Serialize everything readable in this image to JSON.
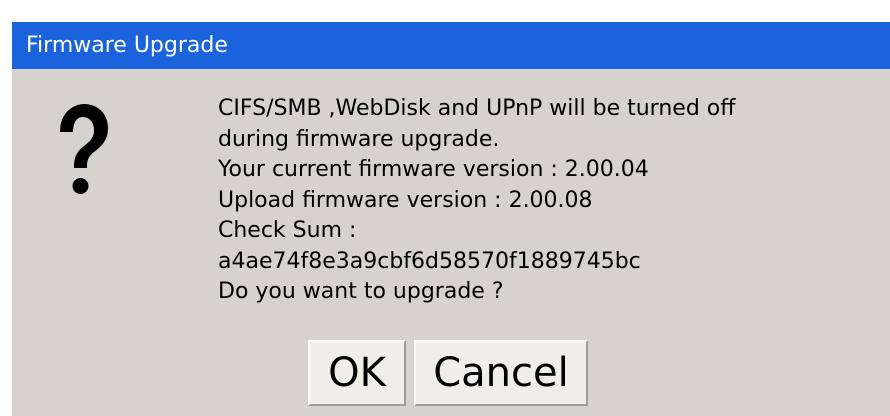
{
  "dialog": {
    "title": "Firmware Upgrade",
    "icon": "question-mark-icon",
    "message_lines": [
      "CIFS/SMB ,WebDisk and UPnP will be turned off",
      "during firmware upgrade.",
      "Your current firmware version : 2.00.04",
      "Upload firmware version : 2.00.08",
      "Check Sum :",
      "a4ae74f8e3a9cbf6d58570f1889745bc",
      "Do you want to upgrade ?"
    ],
    "buttons": {
      "ok_label": "OK",
      "cancel_label": "Cancel"
    }
  },
  "colors": {
    "titlebar": "#1a63dd",
    "dialog_background": "#d6d3ce",
    "button_face": "#efeee9"
  }
}
